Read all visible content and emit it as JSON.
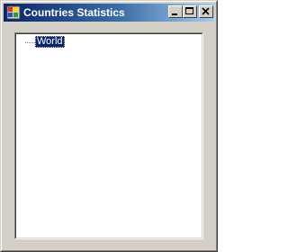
{
  "window": {
    "title": "Countries Statistics",
    "icon": "app-window-icon",
    "controls": {
      "minimize_icon": "minimize-icon",
      "maximize_icon": "maximize-icon",
      "close_icon": "close-icon"
    }
  },
  "tree": {
    "nodes": [
      {
        "label": "World",
        "selected": true
      }
    ]
  },
  "colors": {
    "titlebar_start": "#0a246a",
    "titlebar_end": "#a6caf0",
    "window_face": "#d4d0c8",
    "selection": "#0a246a"
  }
}
